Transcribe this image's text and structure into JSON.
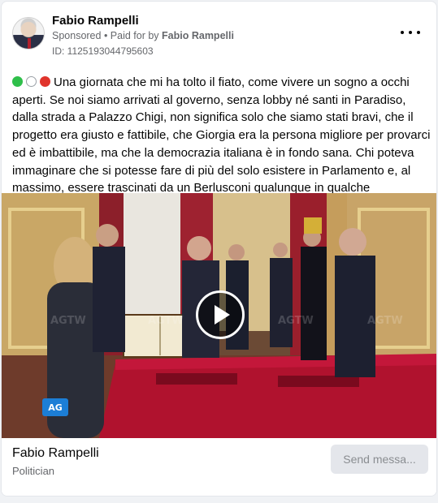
{
  "post": {
    "page_name": "Fabio Rampelli",
    "sponsored_label": "Sponsored",
    "separator": " • ",
    "paid_for_prefix": "Paid for by ",
    "paid_for_by": "Fabio Rampelli",
    "ad_id": "ID: 1125193044795603",
    "text": "Una giornata che mi ha tolto il fiato, come vivere un sogno a occhi aperti. Se noi siamo arrivati al governo, senza lobby né santi in Paradiso, dalla strada a Palazzo Chigi, non significa solo che siamo stati bravi, che il progetto era giusto e fattibile, che Giorgia era la persona migliore per provarci ed è imbattibile, ma che la democrazia italiana è in fondo sana. Chi poteva immaginare che si potesse fare di più del solo esistere in Parlamento e, al massimo, essere trascinati da un Berlusconi qualunque in qualche ministero?...",
    "emoji_dots": [
      "green",
      "white",
      "red"
    ]
  },
  "media": {
    "type": "video",
    "watermark": "AGTW",
    "logo_text": "AG"
  },
  "footer": {
    "name": "Fabio Rampelli",
    "category": "Politician",
    "cta_label": "Send messa..."
  },
  "icons": {
    "menu": "more-horizontal-icon",
    "play": "play-icon"
  }
}
